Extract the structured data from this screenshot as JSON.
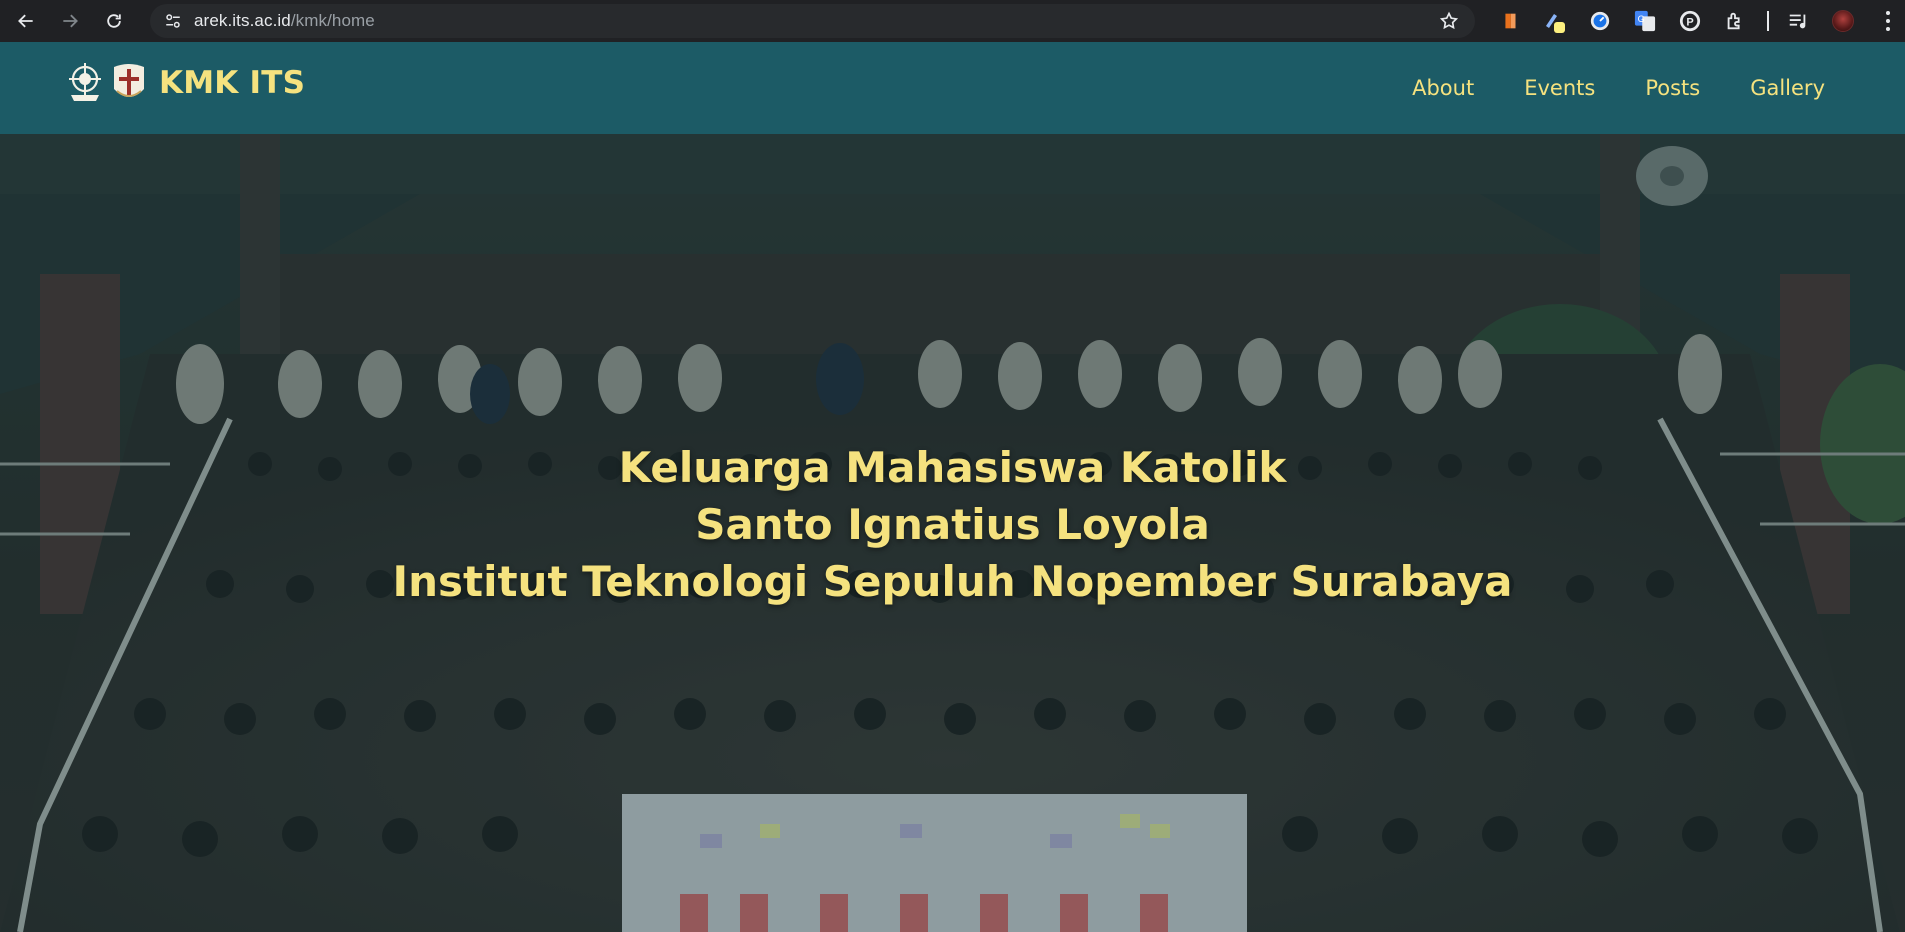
{
  "browser": {
    "url_host": "arek.its.ac.id",
    "url_path": "/kmk/home",
    "icons": [
      "back-icon",
      "forward-icon",
      "reload-icon",
      "site-info-icon",
      "bookmark-star-icon",
      "extensions-icon",
      "media-icon",
      "profile-icon",
      "menu-icon"
    ]
  },
  "site": {
    "brand": "KMK ITS",
    "nav": {
      "about": "About",
      "events": "Events",
      "posts": "Posts",
      "gallery": "Gallery"
    }
  },
  "hero": {
    "line1": "Keluarga Mahasiswa Katolik",
    "line2": "Santo Ignatius Loyola",
    "line3": "Institut Teknologi Sepuluh Nopember Surabaya"
  },
  "colors": {
    "nav_bg": "#1c5b66",
    "accent_yellow": "#f5e27f",
    "browser_bg": "#202124"
  }
}
